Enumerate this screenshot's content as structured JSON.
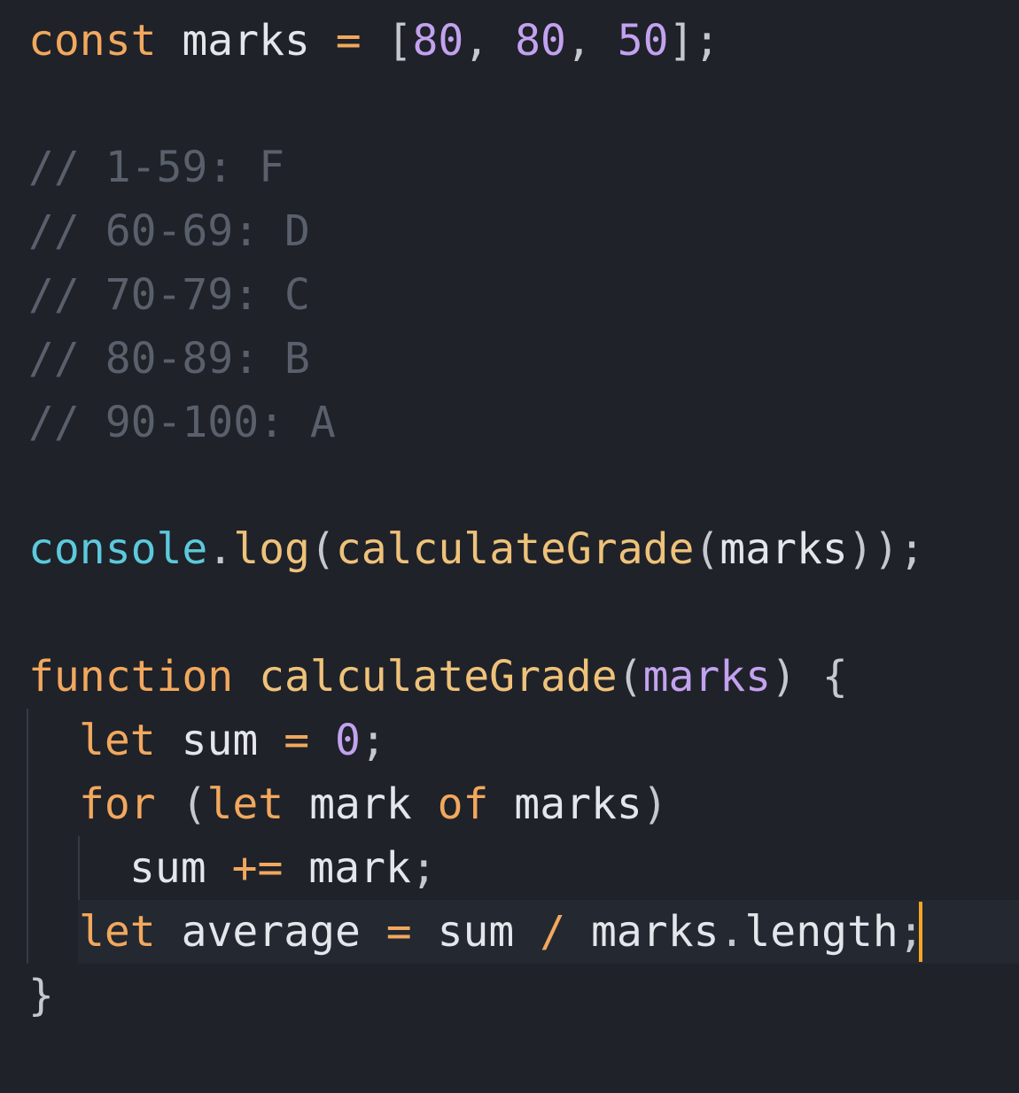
{
  "editor": {
    "language": "javascript",
    "theme_colors": {
      "background": "#1f2229",
      "keyword": "#f2a85d",
      "identifier": "#e3e6ea",
      "number": "#c3a2ef",
      "function": "#efc27a",
      "builtin_object": "#5cc9dc",
      "comment": "#5a606b",
      "cursor": "#f5a623"
    },
    "lines": [
      {
        "tokens": [
          {
            "type": "kw",
            "text": "const"
          },
          {
            "type": "id",
            "text": " marks "
          },
          {
            "type": "op",
            "text": "="
          },
          {
            "type": "punc",
            "text": " ["
          },
          {
            "type": "num",
            "text": "80"
          },
          {
            "type": "punc",
            "text": ", "
          },
          {
            "type": "num",
            "text": "80"
          },
          {
            "type": "punc",
            "text": ", "
          },
          {
            "type": "num",
            "text": "50"
          },
          {
            "type": "punc",
            "text": "];"
          }
        ]
      },
      {
        "tokens": [
          {
            "type": "cmt",
            "text": "// 1-59: F"
          }
        ]
      },
      {
        "tokens": [
          {
            "type": "cmt",
            "text": "// 60-69: D"
          }
        ]
      },
      {
        "tokens": [
          {
            "type": "cmt",
            "text": "// 70-79: C"
          }
        ]
      },
      {
        "tokens": [
          {
            "type": "cmt",
            "text": "// 80-89: B"
          }
        ]
      },
      {
        "tokens": [
          {
            "type": "cmt",
            "text": "// 90-100: A"
          }
        ]
      },
      {
        "tokens": [
          {
            "type": "obj",
            "text": "console"
          },
          {
            "type": "punc",
            "text": "."
          },
          {
            "type": "fn",
            "text": "log"
          },
          {
            "type": "punc",
            "text": "("
          },
          {
            "type": "fn",
            "text": "calculateGrade"
          },
          {
            "type": "punc",
            "text": "("
          },
          {
            "type": "id",
            "text": "marks"
          },
          {
            "type": "punc",
            "text": "));"
          }
        ]
      },
      {
        "tokens": [
          {
            "type": "kw",
            "text": "function"
          },
          {
            "type": "id",
            "text": " "
          },
          {
            "type": "fn",
            "text": "calculateGrade"
          },
          {
            "type": "punc",
            "text": "("
          },
          {
            "type": "param",
            "text": "marks"
          },
          {
            "type": "punc",
            "text": ") {"
          }
        ]
      },
      {
        "tokens": [
          {
            "type": "kw",
            "text": "let"
          },
          {
            "type": "id",
            "text": " sum "
          },
          {
            "type": "op",
            "text": "="
          },
          {
            "type": "id",
            "text": " "
          },
          {
            "type": "num",
            "text": "0"
          },
          {
            "type": "punc",
            "text": ";"
          }
        ]
      },
      {
        "tokens": [
          {
            "type": "kw",
            "text": "for"
          },
          {
            "type": "punc",
            "text": " ("
          },
          {
            "type": "kw",
            "text": "let"
          },
          {
            "type": "id",
            "text": " mark "
          },
          {
            "type": "kw",
            "text": "of"
          },
          {
            "type": "id",
            "text": " marks"
          },
          {
            "type": "punc",
            "text": ")"
          }
        ]
      },
      {
        "tokens": [
          {
            "type": "id",
            "text": "sum "
          },
          {
            "type": "op",
            "text": "+="
          },
          {
            "type": "id",
            "text": " mark"
          },
          {
            "type": "punc",
            "text": ";"
          }
        ]
      },
      {
        "tokens": [
          {
            "type": "kw",
            "text": "let"
          },
          {
            "type": "id",
            "text": " average "
          },
          {
            "type": "op",
            "text": "="
          },
          {
            "type": "id",
            "text": " sum "
          },
          {
            "type": "op",
            "text": "/"
          },
          {
            "type": "id",
            "text": " marks"
          },
          {
            "type": "punc",
            "text": "."
          },
          {
            "type": "id",
            "text": "length"
          },
          {
            "type": "punc",
            "text": ";"
          }
        ]
      },
      {
        "tokens": [
          {
            "type": "punc",
            "text": "}"
          }
        ]
      }
    ]
  }
}
